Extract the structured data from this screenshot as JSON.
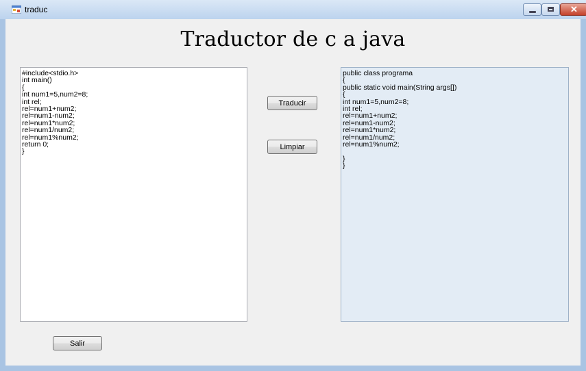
{
  "window": {
    "title": "traduc"
  },
  "header": {
    "title": "Traductor de c a java"
  },
  "input_code": {
    "lines": [
      "#include<stdio.h>",
      "int main()",
      "{",
      "int num1=5,num2=8;",
      "int rel;",
      "rel=num1+num2;",
      "rel=num1-num2;",
      "rel=num1*num2;",
      "rel=num1/num2;",
      "rel=num1%num2;",
      "return 0;",
      "}"
    ]
  },
  "output_code": {
    "lines": [
      "public class programa",
      "{",
      "public static void main(String args[])",
      "{",
      "int num1=5,num2=8;",
      "int rel;",
      "rel=num1+num2;",
      "rel=num1-num2;",
      "rel=num1*num2;",
      "rel=num1/num2;",
      "rel=num1%num2;",
      "",
      "}",
      "}"
    ]
  },
  "buttons": {
    "translate_label": "Traducir",
    "clear_label": "Limpiar",
    "exit_label": "Salir"
  },
  "colors": {
    "titlebar": "#bcd3ee",
    "client_background": "#f0f0f0",
    "output_background": "#e3ecf5",
    "close_button": "#c4412b"
  },
  "icons": {
    "app": "app-window-icon",
    "minimize": "minimize-icon",
    "maximize": "maximize-icon",
    "close": "close-icon"
  }
}
